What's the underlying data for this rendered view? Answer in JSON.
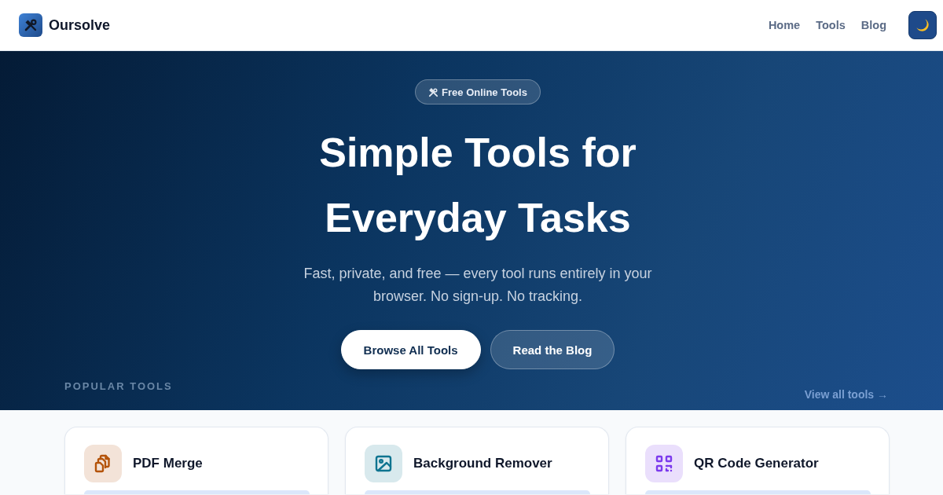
{
  "header": {
    "brand": "Oursolve",
    "nav": [
      {
        "label": "Home"
      },
      {
        "label": "Tools"
      },
      {
        "label": "Blog"
      }
    ]
  },
  "hero": {
    "badge": "Free Online Tools",
    "title": "Simple Tools for Everyday Tasks",
    "subtitle": "Fast, private, and free — every tool runs entirely in your browser. No sign-up. No tracking.",
    "buttons": [
      {
        "label": "Browse All Tools",
        "kind": "primary"
      },
      {
        "label": "Read the Blog",
        "kind": "secondary"
      }
    ]
  },
  "popular": {
    "heading": "POPULAR TOOLS",
    "link": "View all tools →",
    "cards": [
      {
        "title": "PDF Merge",
        "color": "#b45309"
      },
      {
        "title": "Background Remover",
        "color": "#0e7490"
      },
      {
        "title": "QR Code Generator",
        "color": "#7c3aed"
      }
    ]
  }
}
